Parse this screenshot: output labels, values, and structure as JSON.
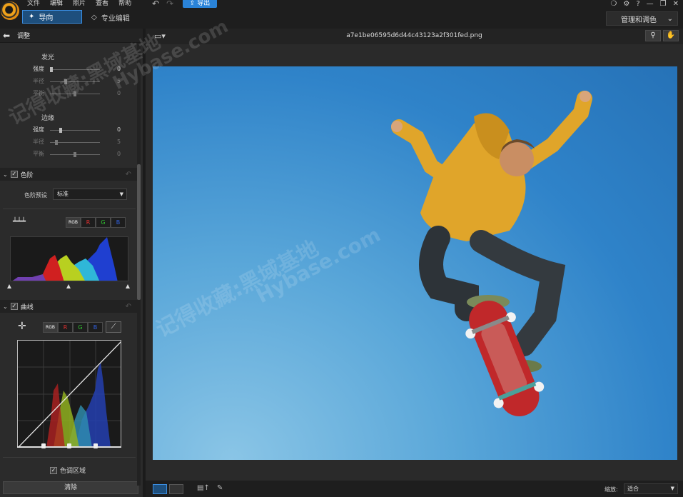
{
  "menu": [
    "文件",
    "编辑",
    "照片",
    "查看",
    "帮助"
  ],
  "toolbar": {
    "export_label": "导出",
    "tab_guide": "导向",
    "tab_pro": "专业编辑",
    "manage_label": "管理和调色"
  },
  "window_controls": [
    "❍",
    "⚙",
    "?",
    "—",
    "❐",
    "✕"
  ],
  "left_panel": {
    "title": "调整",
    "glow": {
      "title": "发光",
      "rows": [
        {
          "label": "强度",
          "value": "0",
          "level": 0.0,
          "dim": false
        },
        {
          "label": "半径",
          "value": "5",
          "level": 0.3,
          "dim": true
        },
        {
          "label": "平衡",
          "value": "0",
          "level": 0.5,
          "dim": true
        }
      ]
    },
    "edge": {
      "title": "边缘",
      "rows": [
        {
          "label": "强度",
          "value": "0",
          "level": 0.2,
          "dim": false
        },
        {
          "label": "半径",
          "value": "5",
          "level": 0.1,
          "dim": true
        },
        {
          "label": "平衡",
          "value": "0",
          "level": 0.5,
          "dim": true
        }
      ]
    },
    "levels": {
      "title": "色阶",
      "preset_label": "色阶预设",
      "preset_value": "标准",
      "channels": [
        "RGB",
        "R",
        "G",
        "B"
      ],
      "handles": [
        0.0,
        0.5,
        1.0
      ]
    },
    "curves": {
      "title": "曲线",
      "channels": [
        "RGB",
        "R",
        "G",
        "B"
      ],
      "handles": [
        0.25,
        0.5,
        0.75
      ],
      "tone_label": "色调区域"
    },
    "clear_label": "清除"
  },
  "viewer": {
    "filename": "a7e1be06595d6d44c43123a2f301fed.png"
  },
  "bottom": {
    "zoom_label": "缩放:",
    "zoom_value": "适合"
  },
  "watermark": {
    "line1": "记得收藏:黑域基地",
    "line2": "Hybase.com"
  },
  "colors": {
    "accent": "#2a83d8",
    "sky": "#3b8fd0",
    "hoodie": "#e0a52a",
    "board": "#c0282a"
  }
}
